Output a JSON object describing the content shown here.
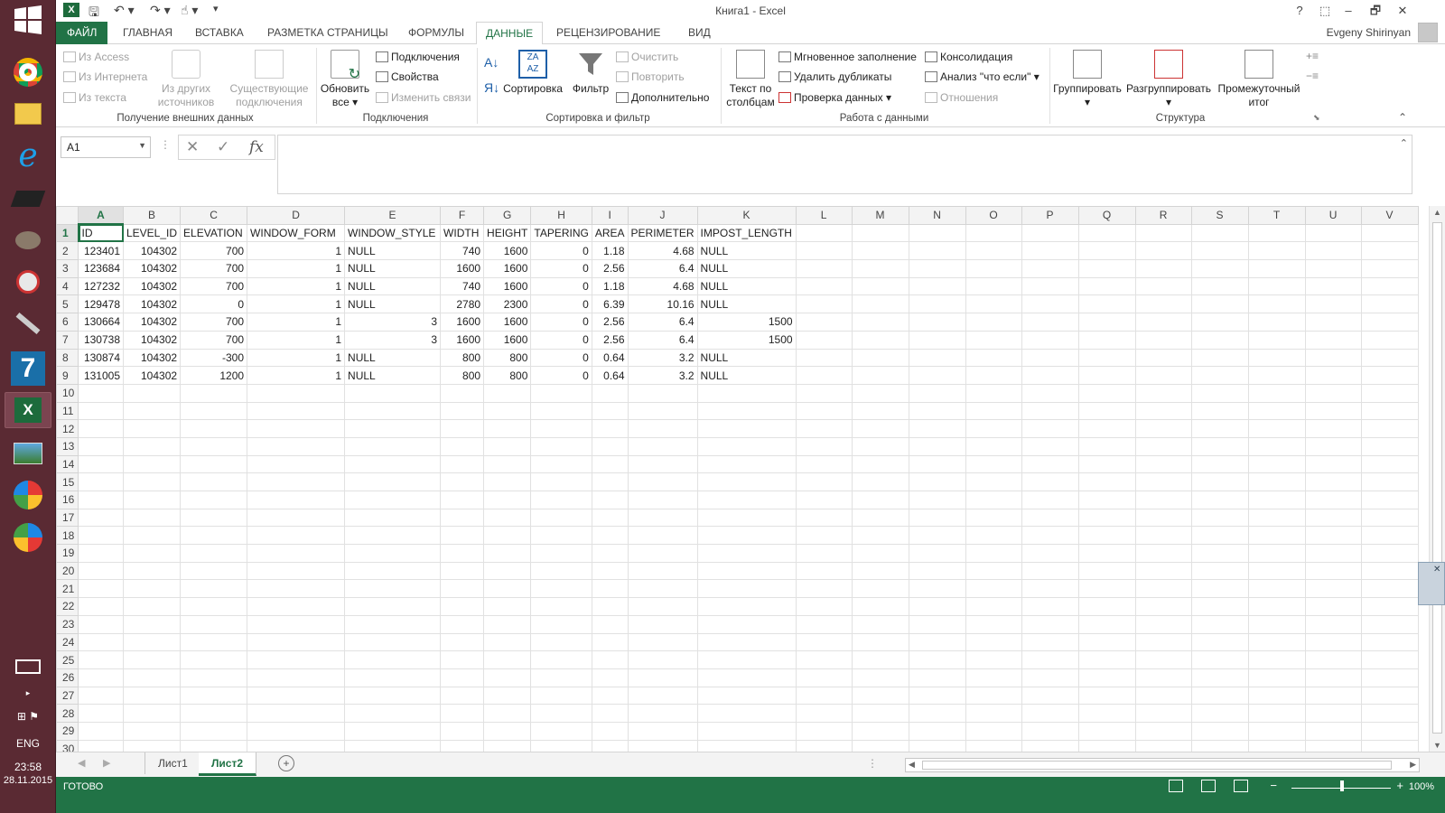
{
  "window": {
    "title": "Книга1 - Excel",
    "user_name": "Evgeny Shirinyan",
    "help_label": "?",
    "minimize_label": "–",
    "restore_label": "🗗",
    "close_label": "✕"
  },
  "ribbon_tabs": [
    "ФАЙЛ",
    "ГЛАВНАЯ",
    "ВСТАВКА",
    "РАЗМЕТКА СТРАНИЦЫ",
    "ФОРМУЛЫ",
    "ДАННЫЕ",
    "РЕЦЕНЗИРОВАНИЕ",
    "ВИД"
  ],
  "active_tab": "ДАННЫЕ",
  "ribbon": {
    "external": {
      "from_access": "Из Access",
      "from_web": "Из Интернета",
      "from_text": "Из текста",
      "from_other": "Из других источников",
      "existing": "Существующие подключения",
      "label": "Получение внешних данных"
    },
    "connections": {
      "refresh_all": "Обновить все",
      "connections": "Подключения",
      "properties": "Свойства",
      "edit_links": "Изменить связи",
      "label": "Подключения"
    },
    "sort_filter": {
      "sort": "Сортировка",
      "filter": "Фильтр",
      "clear": "Очистить",
      "reapply": "Повторить",
      "advanced": "Дополнительно",
      "label": "Сортировка и фильтр"
    },
    "data_tools": {
      "text_to_columns": "Текст по столбцам",
      "flash_fill": "Мгновенное заполнение",
      "remove_duplicates": "Удалить дубликаты",
      "data_validation": "Проверка данных",
      "consolidate": "Консолидация",
      "what_if": "Анализ \"что если\"",
      "relationships": "Отношения",
      "label": "Работа с данными"
    },
    "outline": {
      "group": "Группировать",
      "ungroup": "Разгруппировать",
      "subtotal": "Промежуточный итог",
      "label": "Структура"
    }
  },
  "name_box": "A1",
  "formula": "",
  "columns": [
    "A",
    "B",
    "C",
    "D",
    "E",
    "F",
    "G",
    "H",
    "I",
    "J",
    "K",
    "L",
    "M",
    "N",
    "O",
    "P",
    "Q",
    "R",
    "S",
    "T",
    "U",
    "V"
  ],
  "rows": [
    [
      "ID",
      "LEVEL_ID",
      "ELEVATION",
      "WINDOW_FORM",
      "WINDOW_STYLE",
      "WIDTH",
      "HEIGHT",
      "TAPERING",
      "AREA",
      "PERIMETER",
      "IMPOST_LENGTH"
    ],
    [
      "123401",
      "104302",
      "700",
      "1",
      "NULL",
      "740",
      "1600",
      "0",
      "1.18",
      "4.68",
      "NULL"
    ],
    [
      "123684",
      "104302",
      "700",
      "1",
      "NULL",
      "1600",
      "1600",
      "0",
      "2.56",
      "6.4",
      "NULL"
    ],
    [
      "127232",
      "104302",
      "700",
      "1",
      "NULL",
      "740",
      "1600",
      "0",
      "1.18",
      "4.68",
      "NULL"
    ],
    [
      "129478",
      "104302",
      "0",
      "1",
      "NULL",
      "2780",
      "2300",
      "0",
      "6.39",
      "10.16",
      "NULL"
    ],
    [
      "130664",
      "104302",
      "700",
      "1",
      "3",
      "1600",
      "1600",
      "0",
      "2.56",
      "6.4",
      "1500"
    ],
    [
      "130738",
      "104302",
      "700",
      "1",
      "3",
      "1600",
      "1600",
      "0",
      "2.56",
      "6.4",
      "1500"
    ],
    [
      "130874",
      "104302",
      "-300",
      "1",
      "NULL",
      "800",
      "800",
      "0",
      "0.64",
      "3.2",
      "NULL"
    ],
    [
      "131005",
      "104302",
      "1200",
      "1",
      "NULL",
      "800",
      "800",
      "0",
      "0.64",
      "3.2",
      "NULL"
    ]
  ],
  "visible_row_count": 30,
  "sheets": [
    "Лист1",
    "Лист2"
  ],
  "active_sheet": "Лист2",
  "status": {
    "text": "ГОТОВО",
    "zoom": "100%"
  },
  "tray": {
    "lang": "ENG",
    "time": "23:58",
    "date": "28.11.2015"
  },
  "colors": {
    "accent": "#217346",
    "taskbar": "#5a2a33"
  }
}
